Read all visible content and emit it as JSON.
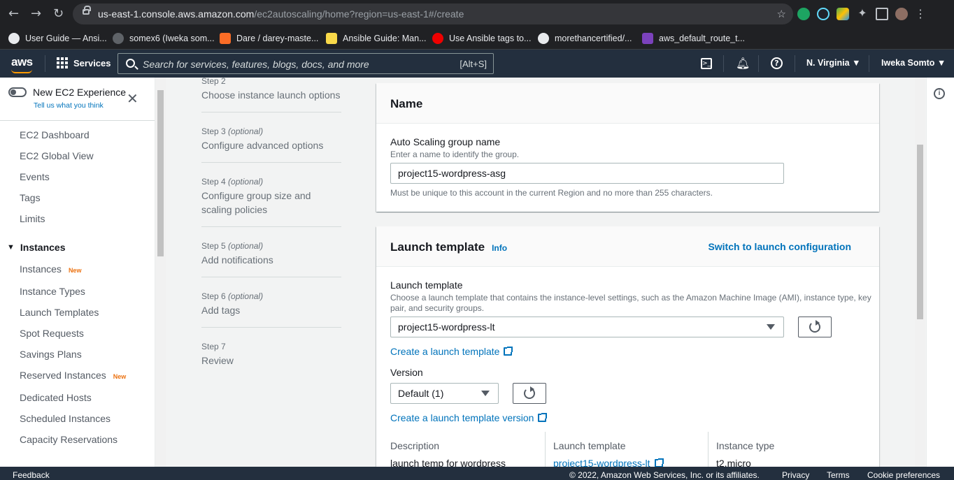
{
  "browser": {
    "url_host": "us-east-1.console.aws.amazon.com",
    "url_path": "/ec2autoscaling/home?region=us-east-1#/create",
    "bookmarks": [
      "User Guide — Ansi...",
      "somex6 (Iweka som...",
      "Dare / darey-maste...",
      "Ansible Guide: Man...",
      "Use Ansible tags to...",
      "morethancertified/...",
      "aws_default_route_t..."
    ]
  },
  "topnav": {
    "logo": "aws",
    "services_label": "Services",
    "search_placeholder": "Search for services, features, blogs, docs, and more",
    "search_shortcut": "[Alt+S]",
    "region": "N. Virginia",
    "user": "Iweka Somto"
  },
  "sidebar": {
    "new_experience": "New EC2 Experience",
    "tell_us": "Tell us what you think",
    "items_top": [
      "EC2 Dashboard",
      "EC2 Global View",
      "Events",
      "Tags",
      "Limits"
    ],
    "section_instances": "Instances",
    "instances_items": [
      {
        "label": "Instances",
        "badge": "New"
      },
      {
        "label": "Instance Types",
        "badge": ""
      },
      {
        "label": "Launch Templates",
        "badge": ""
      },
      {
        "label": "Spot Requests",
        "badge": ""
      },
      {
        "label": "Savings Plans",
        "badge": ""
      },
      {
        "label": "Reserved Instances",
        "badge": "New"
      },
      {
        "label": "Dedicated Hosts",
        "badge": ""
      },
      {
        "label": "Scheduled Instances",
        "badge": ""
      },
      {
        "label": "Capacity Reservations",
        "badge": ""
      }
    ]
  },
  "wizard": {
    "steps": [
      {
        "num": "Step 2",
        "optional": "",
        "title": "Choose instance launch options"
      },
      {
        "num": "Step 3",
        "optional": "(optional)",
        "title": "Configure advanced options"
      },
      {
        "num": "Step 4",
        "optional": "(optional)",
        "title": "Configure group size and scaling policies"
      },
      {
        "num": "Step 5",
        "optional": "(optional)",
        "title": "Add notifications"
      },
      {
        "num": "Step 6",
        "optional": "(optional)",
        "title": "Add tags"
      },
      {
        "num": "Step 7",
        "optional": "",
        "title": "Review"
      }
    ]
  },
  "name_panel": {
    "title": "Name",
    "field_label": "Auto Scaling group name",
    "field_desc": "Enter a name to identify the group.",
    "field_value": "project15-wordpress-asg",
    "constraint": "Must be unique to this account in the current Region and no more than 255 characters."
  },
  "launch_panel": {
    "title": "Launch template",
    "info": "Info",
    "switch_link": "Switch to launch configuration",
    "lt_label": "Launch template",
    "lt_desc": "Choose a launch template that contains the instance-level settings, such as the Amazon Machine Image (AMI), instance type, key pair, and security groups.",
    "lt_value": "project15-wordpress-lt",
    "create_lt_link": "Create a launch template",
    "version_label": "Version",
    "version_value": "Default (1)",
    "create_version_link": "Create a launch template version",
    "details": {
      "description_label": "Description",
      "description_value": "launch temp for wordpress",
      "template_label": "Launch template",
      "template_value": "project15-wordpress-lt",
      "type_label": "Instance type",
      "type_value": "t2.micro"
    }
  },
  "footer": {
    "feedback": "Feedback",
    "copyright": "© 2022, Amazon Web Services, Inc. or its affiliates.",
    "privacy": "Privacy",
    "terms": "Terms",
    "cookies": "Cookie preferences"
  }
}
